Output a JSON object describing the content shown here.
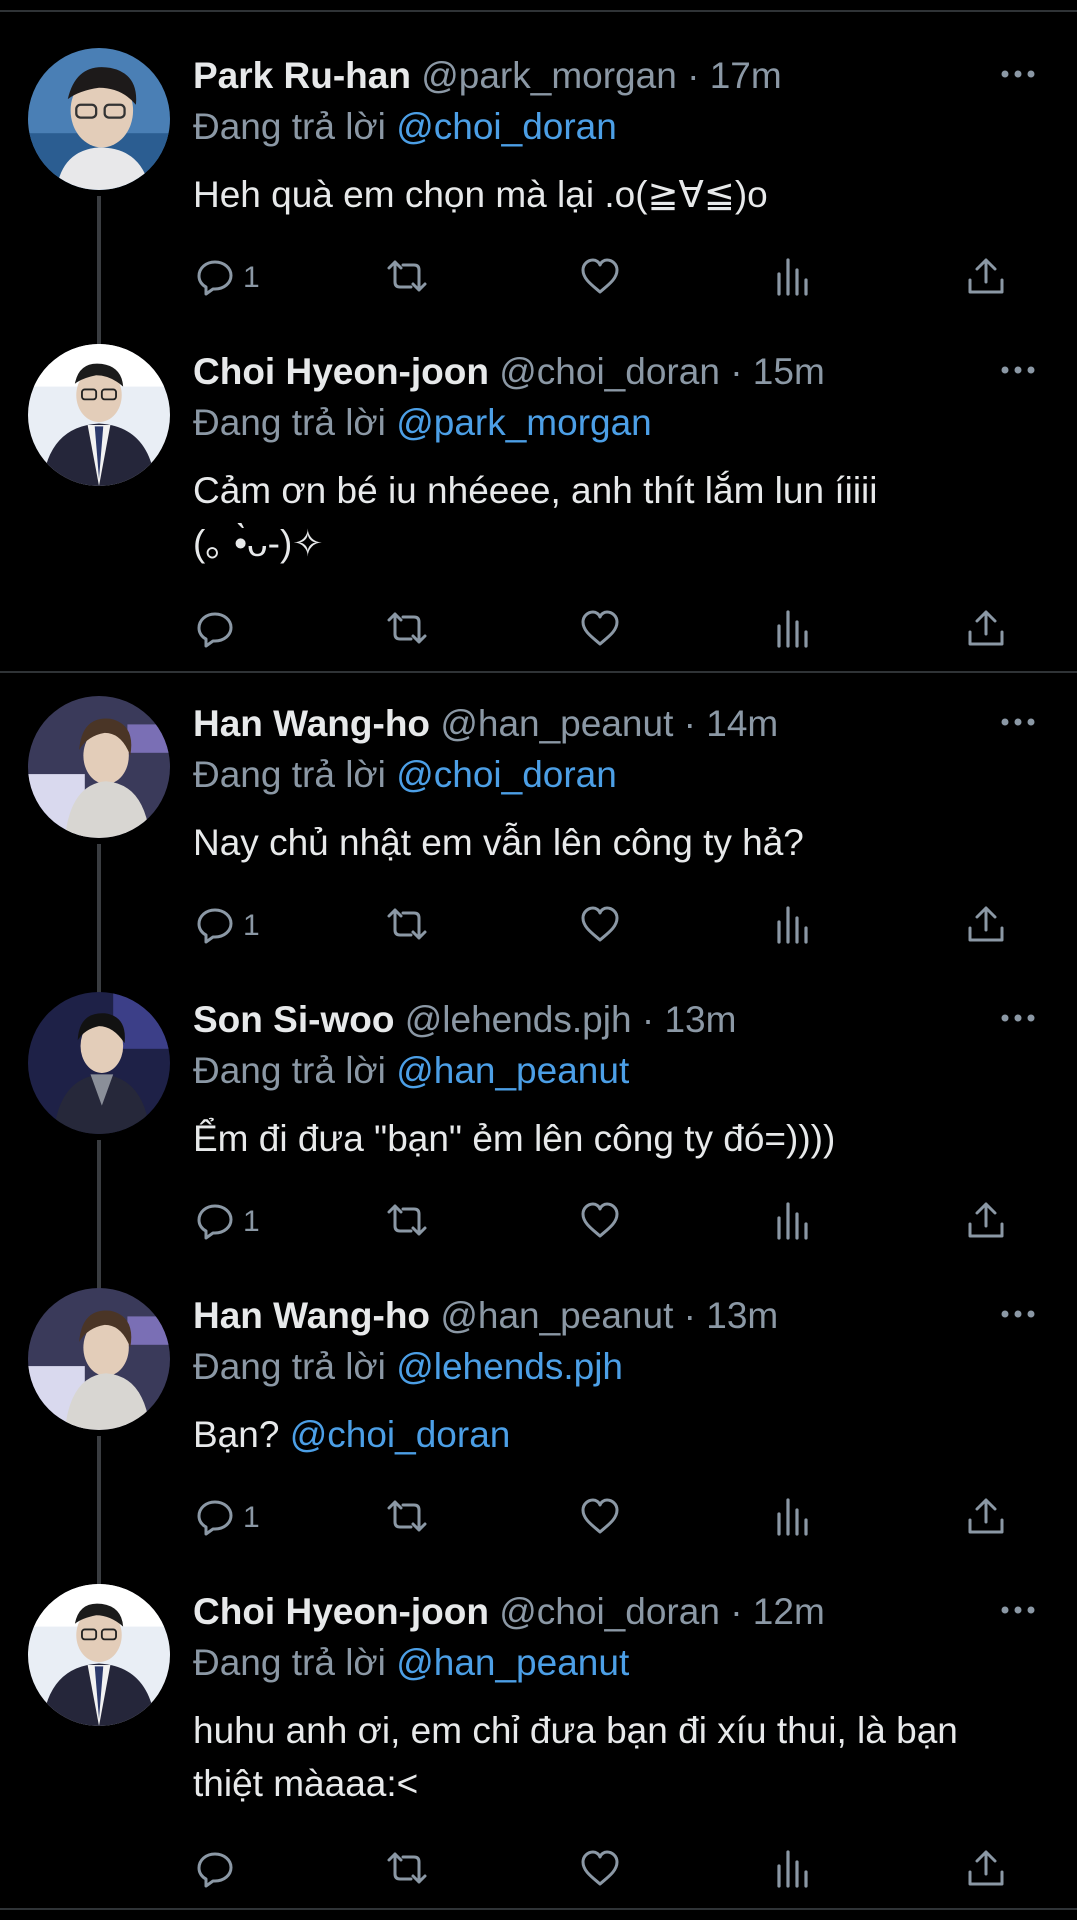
{
  "reply_prefix": "Đang trả lời",
  "tweets": [
    {
      "name": "Park Ru-han",
      "handle": "@park_morgan",
      "dot": "·",
      "time": "17m",
      "reply_to": "@choi_doran",
      "text": "Heh quà em chọn mà lại .o(≧∀≦)o",
      "reply_count": "1"
    },
    {
      "name": "Choi Hyeon-joon",
      "handle": "@choi_doran",
      "dot": "·",
      "time": "15m",
      "reply_to": "@park_morgan",
      "text": "Cảm ơn bé iu nhéeee, anh thít lắm lun íiiii\n(｡ •̀ᴗ-)✧",
      "reply_count": ""
    },
    {
      "name": "Han Wang-ho",
      "handle": "@han_peanut",
      "dot": "·",
      "time": "14m",
      "reply_to": "@choi_doran",
      "text": "Nay chủ nhật em vẫn lên công ty hả?",
      "reply_count": "1"
    },
    {
      "name": "Son Si-woo",
      "handle": "@lehends.pjh",
      "dot": "·",
      "time": "13m",
      "reply_to": "@han_peanut",
      "text": "Ểm đi đưa \"bạn\" ẻm lên công ty đó=))))",
      "reply_count": "1"
    },
    {
      "name": "Han Wang-ho",
      "handle": "@han_peanut",
      "dot": "·",
      "time": "13m",
      "reply_to": "@lehends.pjh",
      "text": "Bạn? ",
      "text_mention": "@choi_doran",
      "reply_count": "1"
    },
    {
      "name": "Choi Hyeon-joon",
      "handle": "@choi_doran",
      "dot": "·",
      "time": "12m",
      "reply_to": "@han_peanut",
      "text": "huhu anh ơi, em chỉ đưa bạn đi xíu thui, là bạn\nthiệt màaaa:<",
      "reply_count": ""
    }
  ],
  "icons": [
    "more-icon",
    "reply-icon",
    "retweet-icon",
    "like-icon",
    "views-icon",
    "share-icon"
  ],
  "colors": {
    "background": "#000000",
    "text": "#e7e9ea",
    "muted": "#8b98a5",
    "mention": "#4c9fe6",
    "divider": "#2f3336"
  }
}
